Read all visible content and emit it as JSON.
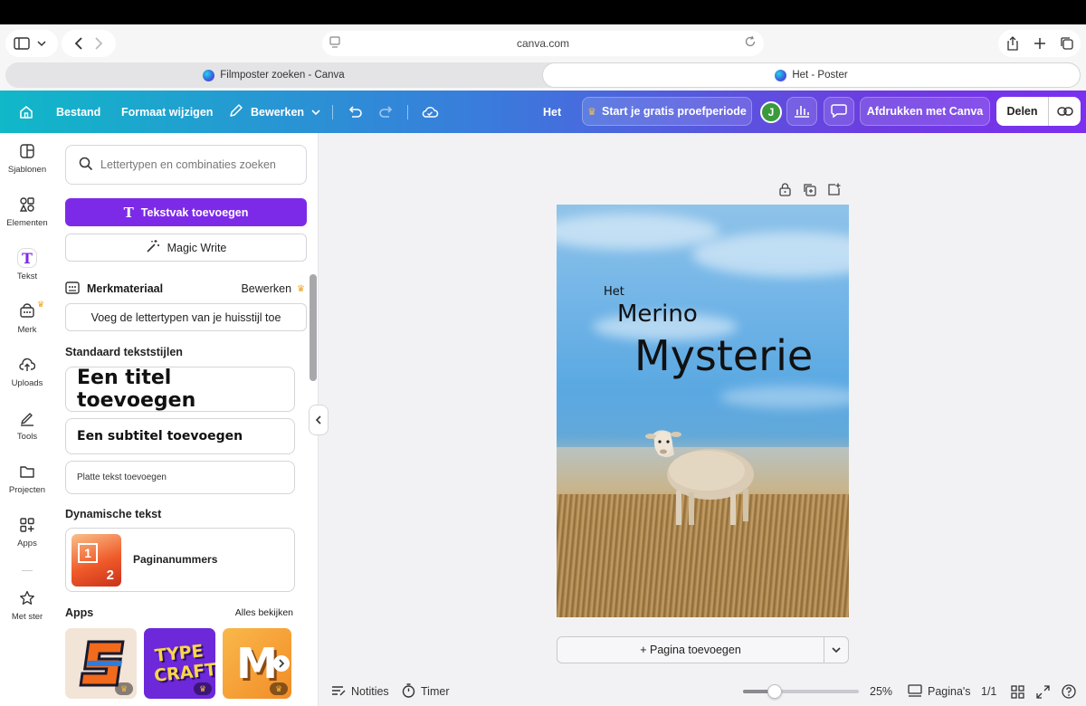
{
  "browser": {
    "url": "canva.com",
    "tabs": [
      {
        "label": "Filmposter zoeken - Canva",
        "active": false
      },
      {
        "label": "Het - Poster",
        "active": true
      }
    ]
  },
  "toolbar": {
    "file": "Bestand",
    "resize": "Formaat wijzigen",
    "edit": "Bewerken",
    "doc_title": "Het",
    "trial": "Start je gratis proefperiode",
    "avatar_initial": "J",
    "print": "Afdrukken met Canva",
    "share": "Delen"
  },
  "rail": {
    "items": [
      {
        "label": "Sjablonen",
        "icon": "templates-icon"
      },
      {
        "label": "Elementen",
        "icon": "elements-icon"
      },
      {
        "label": "Tekst",
        "icon": "text-icon",
        "active": true
      },
      {
        "label": "Merk",
        "icon": "brand-icon"
      },
      {
        "label": "Uploads",
        "icon": "upload-icon"
      },
      {
        "label": "Tools",
        "icon": "tools-icon"
      },
      {
        "label": "Projecten",
        "icon": "folder-icon"
      },
      {
        "label": "Apps",
        "icon": "apps-icon"
      },
      {
        "label": "Met ster",
        "icon": "star-icon"
      }
    ]
  },
  "panel": {
    "search_placeholder": "Lettertypen en combinaties zoeken",
    "add_textbox": "Tekstvak toevoegen",
    "magic_write": "Magic Write",
    "brand_kit": "Merkmateriaal",
    "brand_edit": "Bewerken",
    "brand_fonts": "Voeg de lettertypen van je huisstijl toe",
    "default_styles": "Standaard tekststijlen",
    "add_title": "Een titel toevoegen",
    "add_subtitle": "Een subtitel toevoegen",
    "add_body": "Platte tekst toevoegen",
    "dynamic_text": "Dynamische tekst",
    "page_numbers": "Paginanummers",
    "page_num_1": "1",
    "page_num_2": "2",
    "apps": "Apps",
    "see_all": "Alles bekijken",
    "app_tiles": [
      {
        "name": "app-tile-s",
        "text": "S"
      },
      {
        "name": "app-tile-typecraft",
        "text": "TYPE CRAFT"
      },
      {
        "name": "app-tile-m",
        "text": "M"
      }
    ]
  },
  "poster": {
    "line1": "Het",
    "line2": "Merino",
    "line3": "Mysterie"
  },
  "canvas": {
    "add_page": "+ Pagina toevoegen"
  },
  "bottom": {
    "notes": "Notities",
    "timer": "Timer",
    "zoom": "25%",
    "zoom_fraction": 0.27,
    "pages": "Pagina's",
    "page_count": "1/1"
  },
  "colors": {
    "accent": "#7d2ae8",
    "crown": "#f0a31a"
  }
}
